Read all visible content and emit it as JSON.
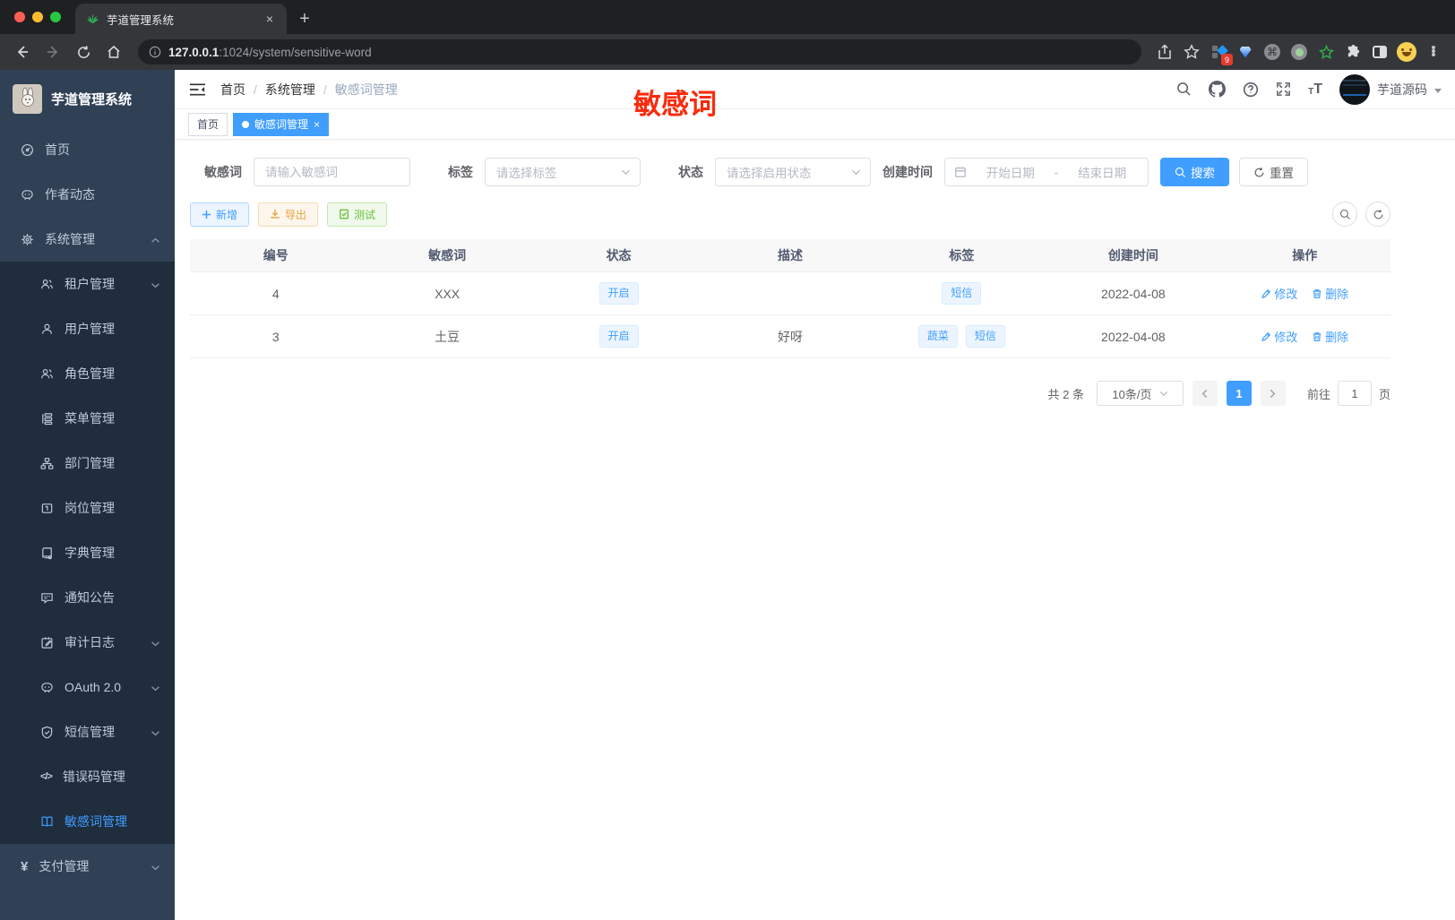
{
  "browser": {
    "tab_title": "芋道管理系统",
    "url_host": "127.0.0.1",
    "url_path": ":1024/system/sensitive-word",
    "extension_badge": "9"
  },
  "sidebar": {
    "app_title": "芋道管理系统",
    "items": [
      {
        "label": "首页",
        "icon": "dashboard-icon"
      },
      {
        "label": "作者动态",
        "icon": "chat-icon"
      },
      {
        "label": "系统管理",
        "icon": "gear-icon"
      },
      {
        "label": "租户管理",
        "icon": "tenants-icon"
      },
      {
        "label": "用户管理",
        "icon": "user-icon"
      },
      {
        "label": "角色管理",
        "icon": "roles-icon"
      },
      {
        "label": "菜单管理",
        "icon": "menu-tree-icon"
      },
      {
        "label": "部门管理",
        "icon": "org-icon"
      },
      {
        "label": "岗位管理",
        "icon": "badge-icon"
      },
      {
        "label": "字典管理",
        "icon": "dictionary-icon"
      },
      {
        "label": "通知公告",
        "icon": "announcement-icon"
      },
      {
        "label": "审计日志",
        "icon": "audit-log-icon"
      },
      {
        "label": "OAuth 2.0",
        "icon": "oauth-icon"
      },
      {
        "label": "短信管理",
        "icon": "sms-shield-icon"
      },
      {
        "label": "错误码管理",
        "icon": "code-icon"
      },
      {
        "label": "敏感词管理",
        "icon": "open-book-icon"
      },
      {
        "label": "支付管理",
        "icon": "pay-icon"
      }
    ]
  },
  "header": {
    "breadcrumb": [
      "首页",
      "系统管理",
      "敏感词管理"
    ],
    "username": "芋道源码"
  },
  "annotation": {
    "text": "敏感词",
    "color": "#fa2b0d"
  },
  "tags_view": {
    "home_tab": "首页",
    "active_tab": "敏感词管理"
  },
  "filters": {
    "keyword": {
      "label": "敏感词",
      "placeholder": "请输入敏感词"
    },
    "tag": {
      "label": "标签",
      "placeholder": "请选择标签"
    },
    "status": {
      "label": "状态",
      "placeholder": "请选择启用状态"
    },
    "create_time": {
      "label": "创建时间",
      "start_placeholder": "开始日期",
      "separator": "-",
      "end_placeholder": "结束日期"
    },
    "search_label": "搜索",
    "reset_label": "重置"
  },
  "toolbar": {
    "add_label": "新增",
    "export_label": "导出",
    "test_label": "测试"
  },
  "table": {
    "columns": [
      "编号",
      "敏感词",
      "状态",
      "描述",
      "标签",
      "创建时间",
      "操作"
    ],
    "rows": [
      {
        "id": "4",
        "word": "XXX",
        "status": "开启",
        "description": "",
        "tag1": "短信",
        "create_time": "2022-04-08"
      },
      {
        "id": "3",
        "word": "土豆",
        "status": "开启",
        "description": "好呀",
        "tag1": "蔬菜",
        "tag2": "短信",
        "create_time": "2022-04-08"
      }
    ],
    "edit_label": "修改",
    "delete_label": "删除"
  },
  "pagination": {
    "total_text": "共 2 条",
    "page_size": "10条/页",
    "current_page": "1",
    "goto_label": "前往",
    "goto_value": "1",
    "page_suffix": "页"
  },
  "colors": {
    "primary": "#409eff",
    "sidebar_bg": "#304156",
    "submenu_bg": "#1f2d3d",
    "warning": "#e6a23c",
    "success": "#67c23a"
  }
}
